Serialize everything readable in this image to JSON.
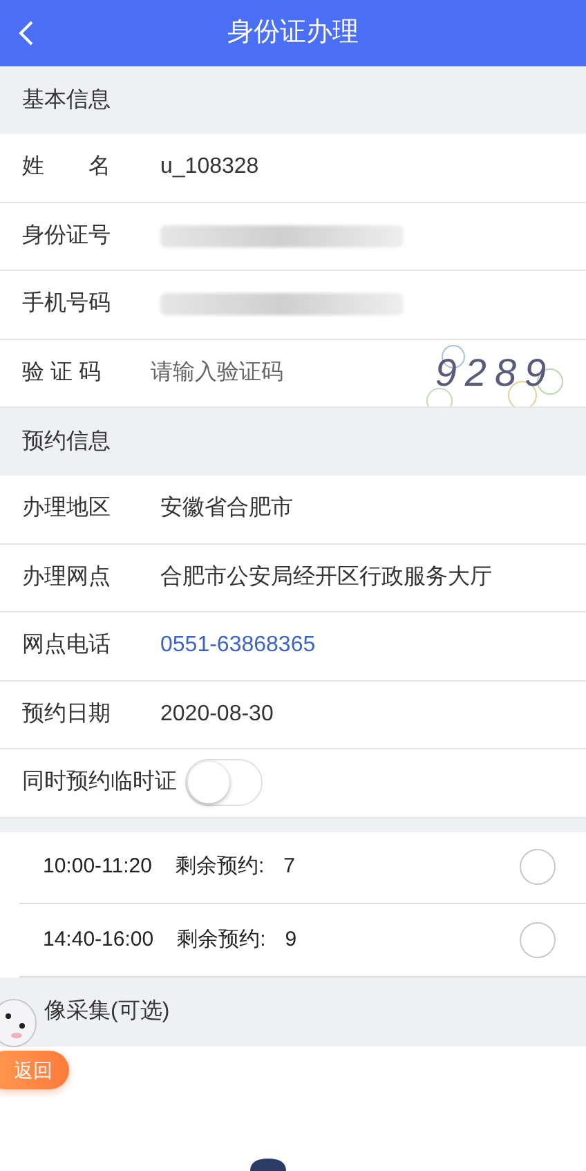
{
  "header": {
    "title": "身份证办理"
  },
  "sections": [
    {
      "title": "基本信息",
      "rows": [
        {
          "kind": "text",
          "label": "姓　　名",
          "value": "u_108328"
        },
        {
          "kind": "blurred",
          "label": "身份证号"
        },
        {
          "kind": "blurred",
          "label": "手机号码"
        },
        {
          "kind": "captcha",
          "label": "验 证 码",
          "placeholder": "请输入验证码",
          "captcha": "9289"
        }
      ]
    },
    {
      "title": "预约信息",
      "rows": [
        {
          "kind": "text",
          "label": "办理地区",
          "value": "安徽省合肥市"
        },
        {
          "kind": "text",
          "label": "办理网点",
          "value": "合肥市公安局经开区行政服务大厅"
        },
        {
          "kind": "link",
          "label": "网点电话",
          "value": "0551-63868365"
        },
        {
          "kind": "text",
          "label": "预约日期",
          "value": "2020-08-30"
        },
        {
          "kind": "toggle",
          "label": "同时预约临时证",
          "on": false
        }
      ]
    }
  ],
  "slots": [
    {
      "time": "10:00-11:20",
      "remaining_label": "剩余预约:",
      "remaining": "7",
      "selected": false
    },
    {
      "time": "14:40-16:00",
      "remaining_label": "剩余预约:",
      "remaining": "9",
      "selected": false
    }
  ],
  "photo_section": {
    "title": "像采集(可选)"
  },
  "float_button": {
    "label": "返回"
  }
}
